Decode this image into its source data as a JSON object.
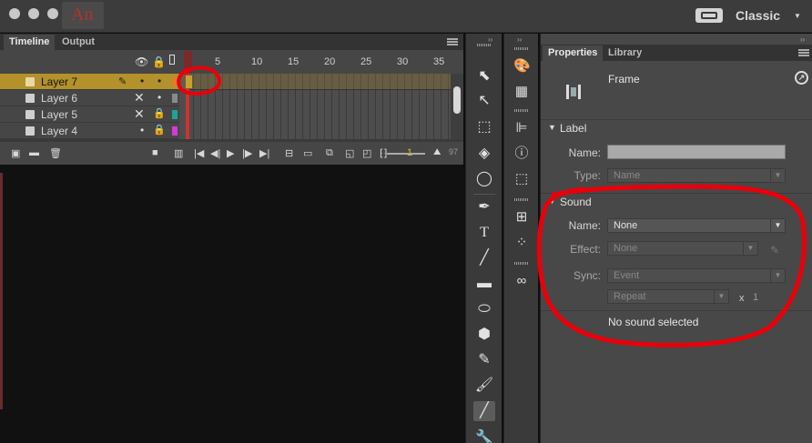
{
  "app": {
    "logo_text": "An",
    "workspace": "Classic"
  },
  "timeline": {
    "tabs": [
      {
        "label": "Timeline",
        "active": true
      },
      {
        "label": "Output",
        "active": false
      }
    ],
    "ruler_ticks": [
      "1",
      "5",
      "10",
      "15",
      "20",
      "25",
      "30",
      "35"
    ],
    "layers": [
      {
        "name": "Layer 7",
        "selected": true
      },
      {
        "name": "Layer 6",
        "selected": false
      },
      {
        "name": "Layer 5",
        "selected": false
      },
      {
        "name": "Layer 4",
        "selected": false
      }
    ],
    "current_frame": "1",
    "fps_partial": "97"
  },
  "properties": {
    "tabs": [
      {
        "label": "Properties",
        "active": true
      },
      {
        "label": "Library",
        "active": false
      }
    ],
    "object_type": "Frame",
    "label_section": {
      "title": "Label",
      "name_label": "Name:",
      "name_value": "",
      "type_label": "Type:",
      "type_value": "Name"
    },
    "sound_section": {
      "title": "Sound",
      "name_label": "Name:",
      "name_value": "None",
      "effect_label": "Effect:",
      "effect_value": "None",
      "sync_label": "Sync:",
      "sync_value": "Event",
      "repeat_value": "Repeat",
      "repeat_x": "x",
      "repeat_count": "1",
      "status": "No sound selected"
    }
  },
  "colors": {
    "selected_layer": "#b3912b",
    "annotation_red": "#e8000b",
    "layer5_color": "#1fa39a",
    "layer4_color": "#d63bd6"
  }
}
